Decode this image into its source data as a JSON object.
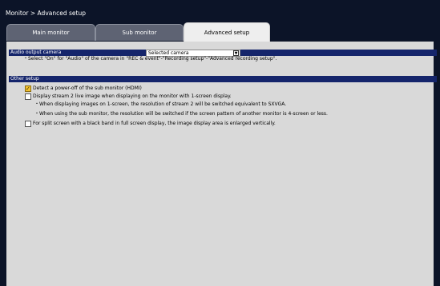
{
  "breadcrumb": "Monitor > Advanced setup",
  "tabs": [
    {
      "label": "Main monitor",
      "active": false
    },
    {
      "label": "Sub monitor",
      "active": false
    },
    {
      "label": "Advanced setup",
      "active": true
    }
  ],
  "audio": {
    "section_title": "Audio output camera",
    "select_value": "Selected camera",
    "note": "・Select \"On\" for \"Audio\" of the camera in \"REC & event\"-\"Recording setup\"-\"Advanced recording setup\"."
  },
  "other": {
    "section_title": "Other setup",
    "options": [
      {
        "label": "Detect a power-off of the sub monitor (HDMI)",
        "checked": true
      },
      {
        "label": "Display stream 2 live image when displaying on the monitor with 1-screen display.",
        "checked": false
      },
      {
        "label": "For split screen with a black band in full screen display, the image display area is enlarged vertically.",
        "checked": false
      }
    ],
    "notes": [
      "・When displaying images on 1-screen, the resolution of stream 2 will be switched equivalent to SXVGA.",
      "・When using the sub monitor, the resolution will be switched if the screen pattern of another monitor is 4-screen or less."
    ]
  },
  "colors": {
    "background": "#0c1428",
    "panel": "#d9d9d9",
    "section_bar": "#15256b",
    "tab_active": "#eeeeee",
    "tab_inactive": "#5e6373",
    "checkbox_checked": "#f2c230"
  }
}
